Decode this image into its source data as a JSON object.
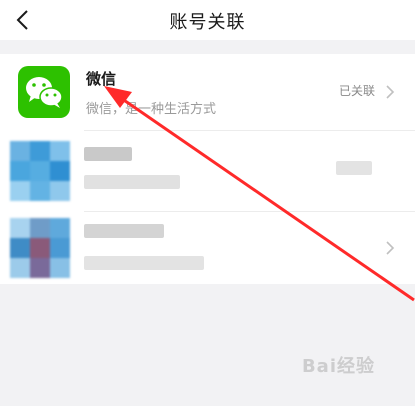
{
  "nav": {
    "title": "账号关联"
  },
  "accounts": [
    {
      "name": "微信",
      "description": "微信，是一种生活方式",
      "status": "已关联",
      "icon": "wechat-icon"
    }
  ],
  "watermark": {
    "text": "Bai经验"
  },
  "colors": {
    "wechat_green": "#2dc100",
    "annotation_arrow": "#ff2a2a",
    "background": "#f2f2f4"
  }
}
